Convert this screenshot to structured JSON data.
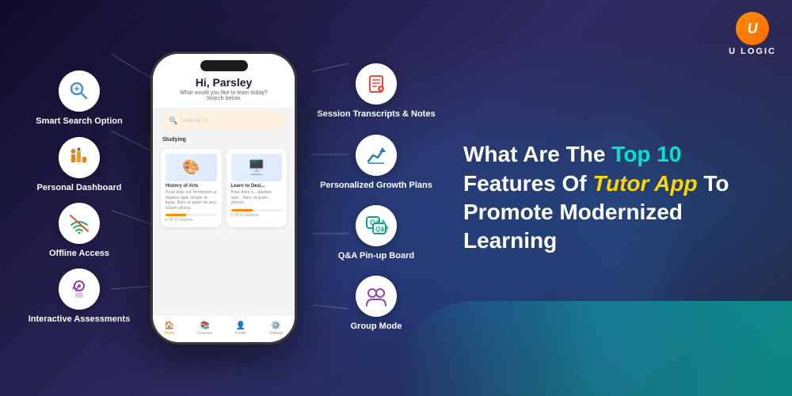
{
  "brand": {
    "name": "U LOGIC",
    "logo_letter": "U"
  },
  "headline": {
    "line1": "What Are The ",
    "highlight1": "Top 10",
    "line2": " Features Of ",
    "highlight2": "Tutor App",
    "line3": " To",
    "line4": "Promote Modernized Learning"
  },
  "left_features": [
    {
      "id": "smart-search",
      "label": "Smart Search\nOption",
      "icon": "🔍",
      "icon_color": "#4a90d9"
    },
    {
      "id": "personal-dashboard",
      "label": "Personal\nDashboard",
      "icon": "📊",
      "icon_color": "#e67e22"
    },
    {
      "id": "offline-access",
      "label": "Offline Access",
      "icon": "📶",
      "icon_color": "#27ae60"
    },
    {
      "id": "interactive-assessments",
      "label": "Interactive\nAssessments",
      "icon": "👆",
      "icon_color": "#8e44ad"
    }
  ],
  "right_features": [
    {
      "id": "session-transcripts",
      "label": "Session\nTranscripts & Notes",
      "icon": "📋",
      "icon_color": "#e74c3c"
    },
    {
      "id": "personalized-growth",
      "label": "Personalized\nGrowth Plans",
      "icon": "📈",
      "icon_color": "#2980b9"
    },
    {
      "id": "qa-pinup",
      "label": "Q&A Pin-up\nBoard",
      "icon": "💬",
      "icon_color": "#16a085"
    },
    {
      "id": "group-mode",
      "label": "Group Mode",
      "icon": "👥",
      "icon_color": "#8e44ad"
    }
  ],
  "phone": {
    "greeting": "Hi, Parsley",
    "subtitle": "What would you like to learn today?\nSearch below.",
    "search_placeholder": "Looking for...",
    "section_label": "Studying",
    "cards": [
      {
        "title": "History of Arts",
        "text": "Proin dolor est, fermentum at dapibus eget, tempor at ligula. Nunc at quam vel arcu rutrum ultrices.",
        "lessons": "4 Of 10 lessons",
        "progress": 40
      },
      {
        "title": "Learn to Desi...",
        "text": "Proin dolor e... dapibus eget... Nunc at quam... ultrices.",
        "lessons": "5 Of 12 lessons",
        "progress": 42
      }
    ],
    "nav_items": [
      {
        "label": "Home",
        "icon": "🏠",
        "active": true
      },
      {
        "label": "Courses",
        "icon": "📚",
        "active": false
      },
      {
        "label": "Profile",
        "icon": "👤",
        "active": false
      },
      {
        "label": "Settings",
        "icon": "⚙️",
        "active": false
      }
    ]
  }
}
